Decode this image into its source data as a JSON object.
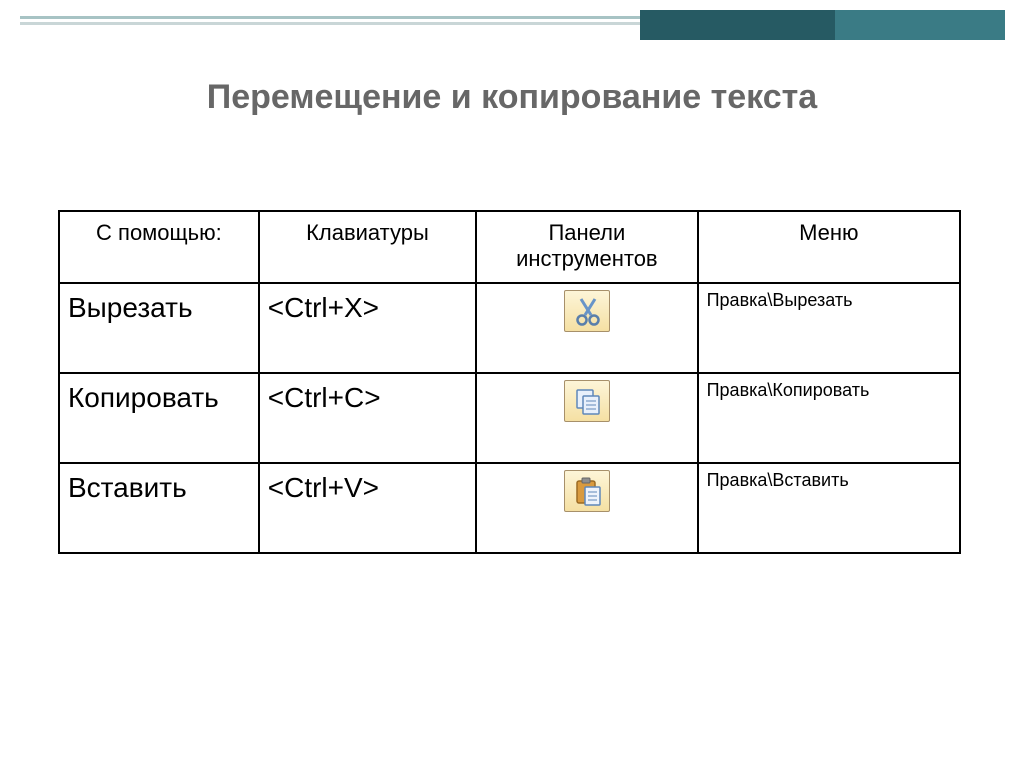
{
  "title": "Перемещение и копирование текста",
  "header": {
    "col1": "С помощью:",
    "col2": "Клавиатуры",
    "col3": "Панели инструментов",
    "col4": "Меню"
  },
  "rows": [
    {
      "action": "Вырезать",
      "shortcut": "<Ctrl+X>",
      "icon": "cut-icon",
      "menu": "Правка\\Вырезать"
    },
    {
      "action": "Копировать",
      "shortcut": "<Ctrl+C>",
      "icon": "copy-icon",
      "menu": "Правка\\Копировать"
    },
    {
      "action": "Вставить",
      "shortcut": "<Ctrl+V>",
      "icon": "paste-icon",
      "menu": "Правка\\Вставить"
    }
  ]
}
